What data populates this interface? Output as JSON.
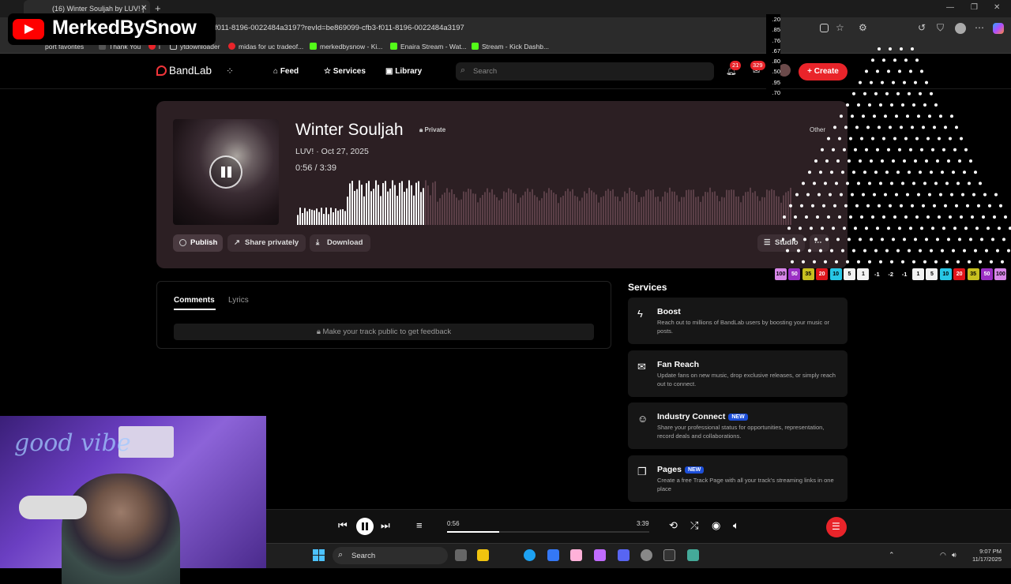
{
  "browser": {
    "tab_title": "(16) Winter Souljah by LUV! |",
    "url": "f011-8196-0022484a3197?revId=be869099-cfb3-f011-8196-0022484a3197",
    "bookmarks": [
      "port favorites",
      "Thank You",
      "i",
      "ytdownloader",
      "midas for uc tradeof...",
      "merkedbysnow - Ki...",
      "Enaira Stream - Wat...",
      "Stream - Kick Dashb..."
    ]
  },
  "overlay": {
    "channel_name": "MerkedBySnow",
    "stats": [
      ".20",
      ".85",
      ".76",
      ".67",
      ".80",
      ".50",
      ".95",
      ".70"
    ],
    "chips": [
      {
        "label": "100",
        "color": "#d786e8"
      },
      {
        "label": "50",
        "color": "#9b2fc4"
      },
      {
        "label": "35",
        "color": "#c7c01f"
      },
      {
        "label": "20",
        "color": "#e0151b"
      },
      {
        "label": "10",
        "color": "#27c7e6"
      },
      {
        "label": "5",
        "color": "#f2f2f2"
      },
      {
        "label": "1",
        "color": "#f2f2f2"
      },
      {
        "label": "-1",
        "color": ""
      },
      {
        "label": "-2",
        "color": ""
      },
      {
        "label": "-1",
        "color": ""
      },
      {
        "label": "1",
        "color": "#f2f2f2"
      },
      {
        "label": "5",
        "color": "#f2f2f2"
      },
      {
        "label": "10",
        "color": "#27c7e6"
      },
      {
        "label": "20",
        "color": "#e0151b"
      },
      {
        "label": "35",
        "color": "#c7c01f"
      },
      {
        "label": "50",
        "color": "#9b2fc4"
      },
      {
        "label": "100",
        "color": "#d786e8"
      }
    ],
    "webcam_sign": "good vibe"
  },
  "bandlab": {
    "logo": "BandLab",
    "nav": {
      "feed": "Feed",
      "services": "Services",
      "library": "Library"
    },
    "search_placeholder": "Search",
    "notifications_count": "21",
    "messages_count": "329",
    "create_label": "Create",
    "accent_color": "#e9242a"
  },
  "track": {
    "title": "Winter Souljah",
    "privacy": "Private",
    "artist_date": "LUV! · Oct 27, 2025",
    "time_readout": "0:56 /  3:39",
    "genre": "Other",
    "played_fraction": 0.256,
    "buttons": {
      "publish": "Publish",
      "share": "Share privately",
      "download": "Download",
      "studio": "Studio"
    }
  },
  "comments": {
    "tab_comments": "Comments",
    "tab_lyrics": "Lyrics",
    "notice": "Make your track public to get feedback"
  },
  "services": {
    "title": "Services",
    "items": [
      {
        "title": "Boost",
        "new": "",
        "desc": "Reach out to millions of BandLab users by boosting your music or posts.",
        "icon": "bolt-icon"
      },
      {
        "title": "Fan Reach",
        "new": "",
        "desc": "Update fans on new music, drop exclusive releases, or simply reach out to connect.",
        "icon": "mail-icon"
      },
      {
        "title": "Industry Connect",
        "new": "NEW",
        "desc": "Share your professional status for opportunities, representation, record deals and collaborations.",
        "icon": "people-icon"
      },
      {
        "title": "Pages",
        "new": "NEW",
        "desc": "Create a free Track Page with all your track's streaming links in one place",
        "icon": "pages-icon"
      }
    ]
  },
  "player": {
    "current": "0:56",
    "duration": "3:39",
    "progress_fraction": 0.256
  },
  "taskbar": {
    "search_label": "Search",
    "time": "9:07 PM",
    "date": "11/17/2025"
  }
}
